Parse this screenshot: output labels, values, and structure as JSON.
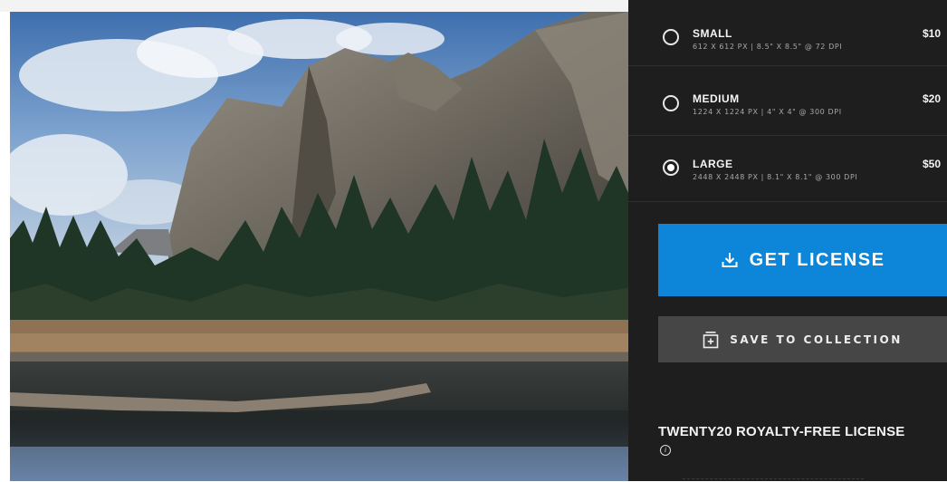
{
  "license_options": [
    {
      "name": "SMALL",
      "spec": "612 X 612 PX | 8.5\" X 8.5\" @ 72 DPI",
      "price": "$10",
      "selected": false
    },
    {
      "name": "MEDIUM",
      "spec": "1224 X 1224 PX | 4\" X 4\" @ 300 DPI",
      "price": "$20",
      "selected": false
    },
    {
      "name": "LARGE",
      "spec": "2448 X 2448 PX | 8.1\" X 8.1\" @ 300 DPI",
      "price": "$50",
      "selected": true
    }
  ],
  "buttons": {
    "get_license": "GET LICENSE",
    "save_to_collection": "SAVE TO COLLECTION"
  },
  "license_info": {
    "title": "TWENTY20 ROYALTY-FREE LICENSE",
    "info_glyph": "i"
  },
  "icons": {
    "get_license": "download-icon",
    "save": "collection-add-icon",
    "info": "info-icon"
  },
  "colors": {
    "panel_bg": "#1e1e1e",
    "primary_button": "#0d85d8",
    "secondary_button": "#464646"
  }
}
